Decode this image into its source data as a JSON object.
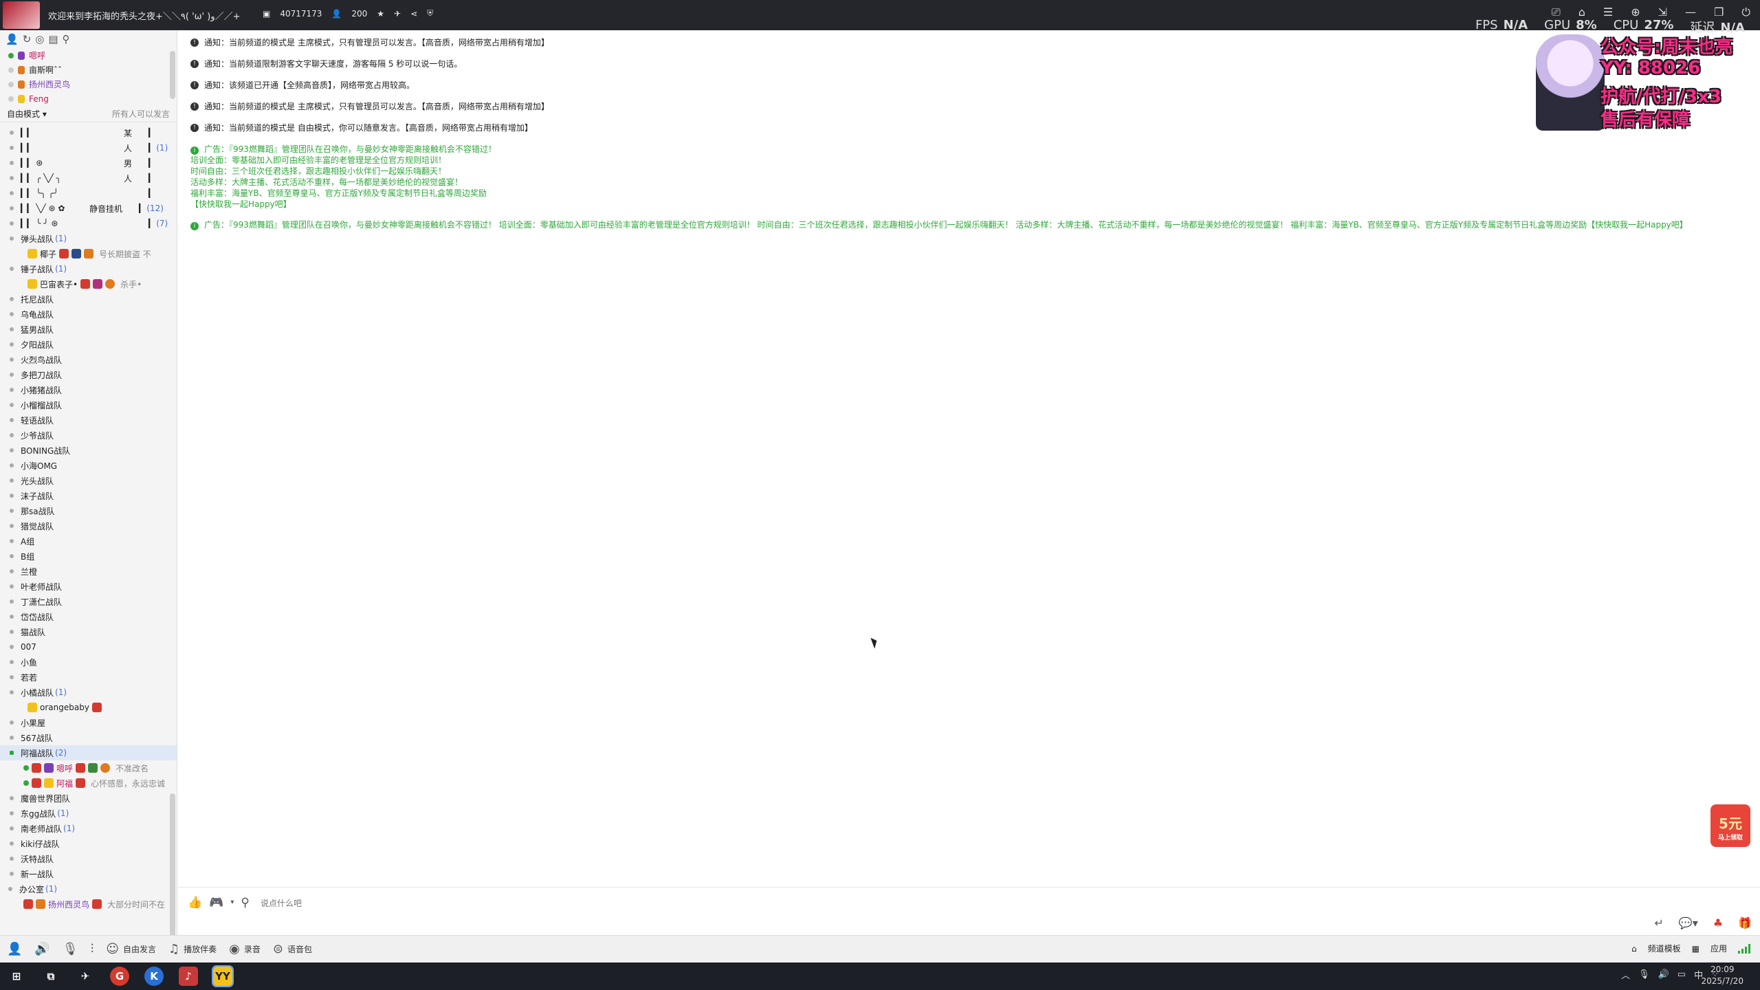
{
  "titlebar": {
    "room_title": "欢迎来到李拓海的秃头之夜+＼＼٩( 'ω' )و／／+",
    "room_id": "40717173",
    "online_count": "200",
    "fps_label": "FPS",
    "fps_value": "N/A",
    "gpu_label": "GPU",
    "gpu_value": "8%",
    "cpu_label": "CPU",
    "cpu_value": "27%",
    "latency_label": "延迟",
    "latency_value": "N/A"
  },
  "promo": {
    "line1": "公众号:周末也亮",
    "line2": "YY: 88026",
    "line3": "护航/代打/3x3",
    "line4": "售后有保障"
  },
  "friends": [
    {
      "name": "嗯呼",
      "color": "#c2185b"
    },
    {
      "name": "亩斯啊ˆˆ",
      "color": "#222"
    },
    {
      "name": "扬州西灵鸟",
      "color": "#7b3fb5"
    },
    {
      "name": "Feng",
      "color": "#c2185b"
    }
  ],
  "mode": {
    "left": "自由模式 ▾",
    "right": "所有人可以发言"
  },
  "tree": {
    "top_rows": [
      {
        "left": "▎▎",
        "mid": "某",
        "count": ""
      },
      {
        "left": "▎▎",
        "mid": "人",
        "count": "(1)"
      },
      {
        "left": "▎▎      ⊛",
        "mid": "男",
        "count": ""
      },
      {
        "left": "▎▎  ╭ ╲╱ ╮",
        "mid": "人",
        "count": ""
      },
      {
        "left": "▎▎  ╰╮ ╭╯",
        "mid": "",
        "count": ""
      },
      {
        "left": "▎▎  ╲╱ ⊛  ✿",
        "mid": "静音挂机",
        "count": "(12)"
      },
      {
        "left": "▎▎  ╰ ╯    ⊛",
        "mid": "",
        "count": "(7)"
      }
    ],
    "group1": {
      "name": "弹头战队",
      "count": "(1)"
    },
    "group1_user": {
      "name": "椰子",
      "sig": "号长期披盗 不"
    },
    "group2": {
      "name": "锤子战队",
      "count": "(1)"
    },
    "group2_user": {
      "name": "巴宙表子•",
      "sig": "杀手•"
    },
    "groups_a": [
      "托尼战队",
      "乌龟战队",
      "猛男战队",
      "夕阳战队",
      "火烈鸟战队",
      "多把刀战队",
      "小猪猪战队",
      "小榴榴战队",
      "轻语战队",
      "少爷战队",
      "BONING战队",
      "小海OMG",
      "光头战队",
      "沫子战队",
      "那sa战队",
      "猎觉战队",
      "A组",
      "B组",
      "兰橙",
      "叶老师战队",
      "丁潇仁战队",
      "岱岱战队",
      "猫战队",
      "007",
      "小鱼",
      "若若"
    ],
    "group3": {
      "name": "小橘战队",
      "count": "(1)"
    },
    "group3_user": {
      "name": "orangebaby"
    },
    "groups_b": [
      "小果屋",
      "567战队"
    ],
    "group4": {
      "name": "阿福战队",
      "count": "(2)"
    },
    "group4_users": [
      {
        "name": "嗯呼",
        "sig": "不准改名"
      },
      {
        "name": "阿福",
        "sig": "心怀感恩，永远忠诚"
      }
    ],
    "groups_c": [
      {
        "name": "魔兽世界团队",
        "count": ""
      },
      {
        "name": "东gg战队",
        "count": "(1)"
      },
      {
        "name": "南老师战队",
        "count": "(1)"
      },
      {
        "name": "kiki仔战队",
        "count": ""
      },
      {
        "name": "沃特战队",
        "count": ""
      },
      {
        "name": "新一战队",
        "count": ""
      }
    ],
    "office": {
      "name": "办公室",
      "count": "(1)"
    },
    "office_user": {
      "name": "扬州西灵鸟",
      "sig": "大部分时间不在"
    }
  },
  "chat": {
    "notices": [
      "通知：当前频道的模式是 主席模式，只有管理员可以发言。【高音质，网络带宽占用稍有增加】",
      "通知：当前频道限制游客文字聊天速度，游客每隔 5 秒可以说一句话。",
      "通知：该频道已开通【全频高音质】，网络带宽占用较高。",
      "通知：当前频道的模式是 主席模式，只有管理员可以发言。【高音质，网络带宽占用稍有增加】",
      "通知：当前频道的模式是 自由模式，你可以随意发言。【高音质，网络带宽占用稍有增加】"
    ],
    "ad1_lines": [
      "广告：『993燃舞蹈』管理团队在召唤你，与曼妙女神零距离接触机会不容错过！",
      "培训全面：零基础加入即可由经验丰富的老管理是全位官方规则培训！",
      "时间自由：三个班次任君选择，跟志趣相投小伙伴们一起娱乐嗨翻天！",
      "活动多样：大牌主播、花式活动不重样，每一场都是美妙绝伦的视觉盛宴！",
      "福利丰富：海量YB、官频至尊皇马、官方正版Y频及专属定制节日礼盒等周边奖励",
      "【快快取我一起Happy吧】"
    ],
    "ad2": "广告：『993燃舞蹈』管理团队在召唤你，与曼妙女神零距离接触机会不容错过！ 培训全面：零基础加入即可由经验丰富的老管理是全位官方规则培训！ 时间自由：三个班次任君选择，跟志趣相投小伙伴们一起娱乐嗨翻天！ 活动多样：大牌主播、花式活动不重样，每一场都是美妙绝伦的视觉盛宴！ 福利丰富：海量YB、官频至尊皇马、官方正版Y频及专属定制节日礼盒等周边奖励【快快取我一起Happy吧】"
  },
  "redpacket": {
    "amount": "5元",
    "sub": "马上领取"
  },
  "input": {
    "placeholder": "说点什么吧"
  },
  "bottombar": {
    "free_speech": "自由发言",
    "play_music": "播放伴奏",
    "record": "录音",
    "voice_pack": "语音包",
    "channel_template": "频道模板",
    "apps": "应用"
  },
  "taskbar": {
    "time": "20:09",
    "date": "2025/7/20",
    "ime": "中"
  }
}
